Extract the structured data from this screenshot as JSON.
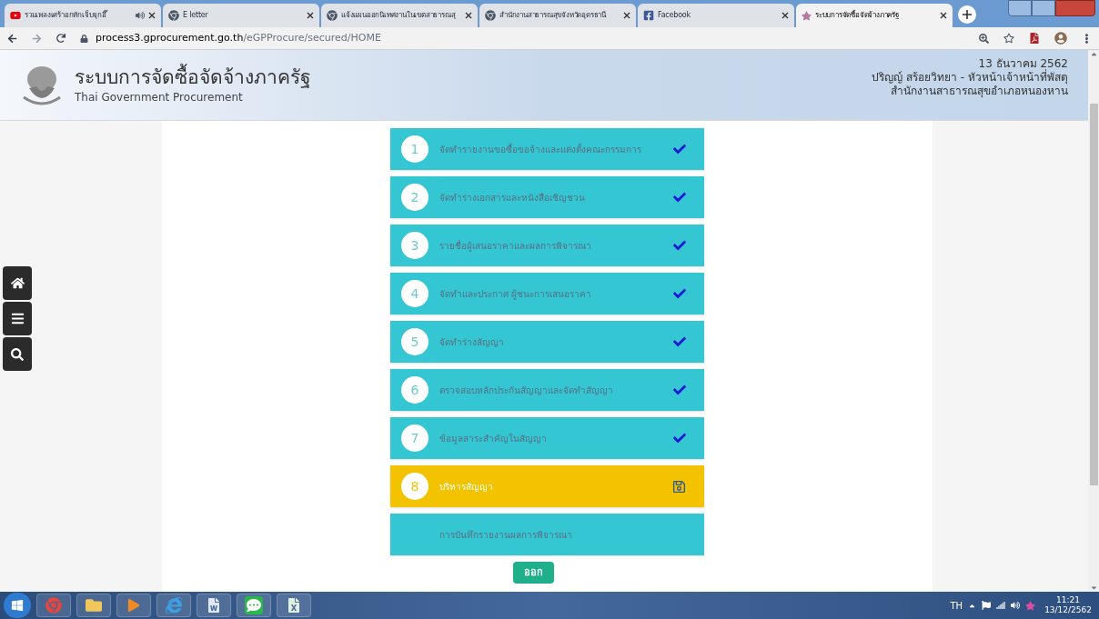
{
  "browser": {
    "tabs": [
      {
        "title": "รวมเพลงเศร้าอกหักเจ็บจุกอึ๊",
        "kind": "video",
        "audio": true,
        "selected": false
      },
      {
        "title": "E letter",
        "kind": "globe",
        "audio": false,
        "selected": false
      },
      {
        "title": "แจ้งแผนออกนิเทศงานในเขตสาธารณสุ",
        "kind": "globe",
        "audio": false,
        "selected": false
      },
      {
        "title": "สำนักงานสาธารณสุขจังหวัดอุดรธานี",
        "kind": "globe",
        "audio": false,
        "selected": false
      },
      {
        "title": "Facebook",
        "kind": "social",
        "audio": false,
        "selected": false
      },
      {
        "title": "ระบบการจัดซื้อจัดจ้างภาครัฐ",
        "kind": "emblem",
        "audio": false,
        "selected": true
      }
    ],
    "url_host": "process3.gprocurement.go.th",
    "url_path": "/eGPProcure/secured/HOME"
  },
  "header": {
    "title": "ระบบการจัดซื้อจัดจ้างภาครัฐ",
    "subtitle": "Thai Government Procurement",
    "date": "13 ธันวาคม 2562",
    "user": "ปริญญ์ สร้อยวิทยา - หัวหน้าเจ้าหน้าที่พัสดุ",
    "office": "สำนักงานสาธารณสุขอำเภอหนองหาน"
  },
  "steps": [
    {
      "number": "1",
      "label": "จัดทำรายงานขอซื้อขอจ้างและแต่งตั้งคณะกรรมการ",
      "completed": true,
      "selected": false
    },
    {
      "number": "2",
      "label": "จัดทำร่างเอกสารและหนังสือเชิญชวน",
      "completed": true,
      "selected": false
    },
    {
      "number": "3",
      "label": "รายชื่อผู้เสนอราคาและผลการพิจารณา",
      "completed": true,
      "selected": false
    },
    {
      "number": "4",
      "label": "จัดทำและประกาศ ผู้ชนะการเสนอราคา",
      "completed": true,
      "selected": false
    },
    {
      "number": "5",
      "label": "จัดทำร่างสัญญา",
      "completed": true,
      "selected": false
    },
    {
      "number": "6",
      "label": "ตรวจสอบหลักประกันสัญญาและจัดทำสัญญา",
      "completed": true,
      "selected": false
    },
    {
      "number": "7",
      "label": "ข้อมูลสาระสำคัญในสัญญา",
      "completed": true,
      "selected": false
    },
    {
      "number": "8",
      "label": "บริหารสัญญา",
      "completed": false,
      "selected": true
    },
    {
      "label": "การบันทึกรายงานผลการพิจารณา",
      "completed": false,
      "selected": false
    }
  ],
  "exit_button": "ออก",
  "taskbar": {
    "language": "TH",
    "time": "11:21",
    "date": "13/12/2562"
  }
}
